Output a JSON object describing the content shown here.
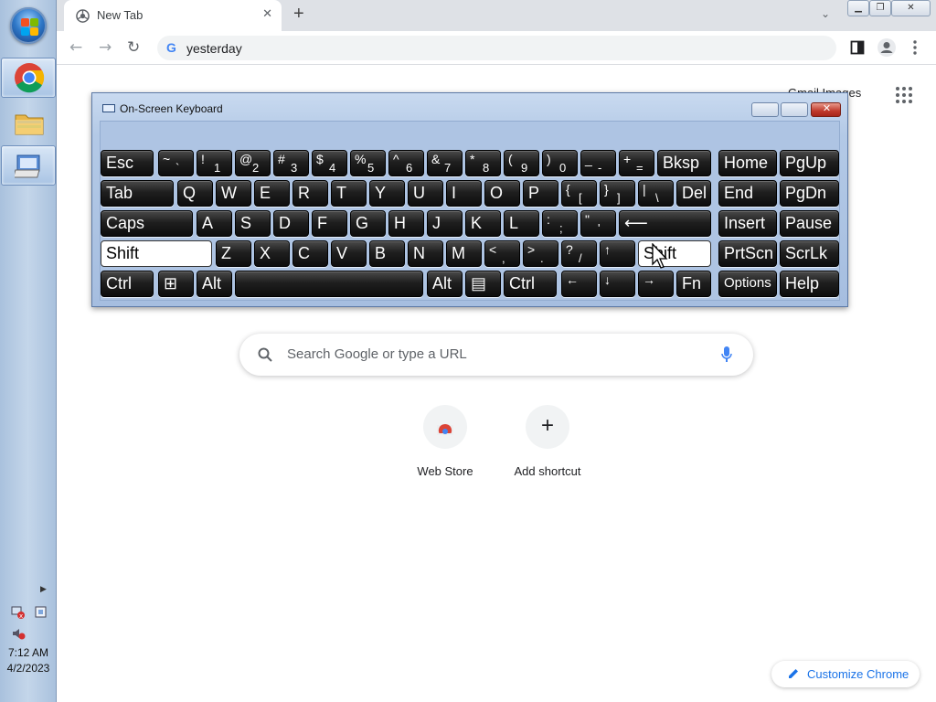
{
  "taskbar": {
    "start_icon": "windows-orb",
    "apps": [
      "chrome-icon",
      "folder-icon",
      "on-screen-keyboard-icon"
    ],
    "tray_icons": [
      "show-hidden-icons",
      "network-error-icon",
      "action-center-icon",
      "volume-muted-icon"
    ],
    "clock_time": "7:12 AM",
    "clock_date": "4/2/2023"
  },
  "browser": {
    "tab_title": "New Tab",
    "tab_close": "✕",
    "new_tab": "+",
    "tab_search": "⌄",
    "window_buttons": [
      "▁",
      "❐",
      "✕"
    ],
    "back": "←",
    "forward": "→",
    "reload": "↻",
    "address_value": "yesterday",
    "google_g": "G",
    "top_links": "Gmail  Images",
    "search_placeholder": "Search Google or type a URL",
    "shortcuts": [
      {
        "label": "Web Store",
        "icon": "web-store-icon"
      },
      {
        "label": "Add shortcut",
        "icon": "plus-icon",
        "glyph": "+"
      }
    ],
    "customize_label": "Customize Chrome"
  },
  "osk": {
    "title": "On-Screen Keyboard",
    "rows": [
      [
        {
          "l": "Esc"
        },
        {
          "s": "~",
          "b": "`"
        },
        {
          "s": "!",
          "b": "1"
        },
        {
          "s": "@",
          "b": "2"
        },
        {
          "s": "#",
          "b": "3"
        },
        {
          "s": "$",
          "b": "4"
        },
        {
          "s": "%",
          "b": "5"
        },
        {
          "s": "^",
          "b": "6"
        },
        {
          "s": "&",
          "b": "7"
        },
        {
          "s": "*",
          "b": "8"
        },
        {
          "s": "(",
          "b": "9"
        },
        {
          "s": ")",
          "b": "0"
        },
        {
          "s": "_",
          "b": "-"
        },
        {
          "s": "+",
          "b": "="
        },
        {
          "l": "Bksp"
        },
        {
          "l": "Home"
        },
        {
          "l": "PgUp"
        }
      ],
      [
        {
          "l": "Tab"
        },
        {
          "l": "Q"
        },
        {
          "l": "W"
        },
        {
          "l": "E"
        },
        {
          "l": "R"
        },
        {
          "l": "T"
        },
        {
          "l": "Y"
        },
        {
          "l": "U"
        },
        {
          "l": "I"
        },
        {
          "l": "O"
        },
        {
          "l": "P"
        },
        {
          "s": "{",
          "b": "["
        },
        {
          "s": "}",
          "b": "]"
        },
        {
          "s": "|",
          "b": "\\"
        },
        {
          "l": "Del"
        },
        {
          "l": "End"
        },
        {
          "l": "PgDn"
        }
      ],
      [
        {
          "l": "Caps"
        },
        {
          "l": "A"
        },
        {
          "l": "S"
        },
        {
          "l": "D"
        },
        {
          "l": "F"
        },
        {
          "l": "G"
        },
        {
          "l": "H"
        },
        {
          "l": "J"
        },
        {
          "l": "K"
        },
        {
          "l": "L"
        },
        {
          "s": ":",
          "b": ";"
        },
        {
          "s": "\"",
          "b": "'"
        },
        {
          "l": "⟵"
        },
        {
          "l": "Insert"
        },
        {
          "l": "Pause"
        }
      ],
      [
        {
          "l": "Shift"
        },
        {
          "l": "Z"
        },
        {
          "l": "X"
        },
        {
          "l": "C"
        },
        {
          "l": "V"
        },
        {
          "l": "B"
        },
        {
          "l": "N"
        },
        {
          "l": "M"
        },
        {
          "s": "<",
          "b": ","
        },
        {
          "s": ">",
          "b": "."
        },
        {
          "s": "?",
          "b": "/"
        },
        {
          "s": "↑"
        },
        {
          "l": "Shift"
        },
        {
          "l": "PrtScn"
        },
        {
          "l": "ScrLk"
        }
      ],
      [
        {
          "l": "Ctrl"
        },
        {
          "l": "⊞"
        },
        {
          "l": "Alt"
        },
        {
          "l": ""
        },
        {
          "l": "Alt"
        },
        {
          "l": "▤"
        },
        {
          "l": "Ctrl"
        },
        {
          "s": "←"
        },
        {
          "s": "↓"
        },
        {
          "s": "→"
        },
        {
          "l": "Fn"
        },
        {
          "l": "Options"
        },
        {
          "l": "Help"
        }
      ]
    ]
  }
}
